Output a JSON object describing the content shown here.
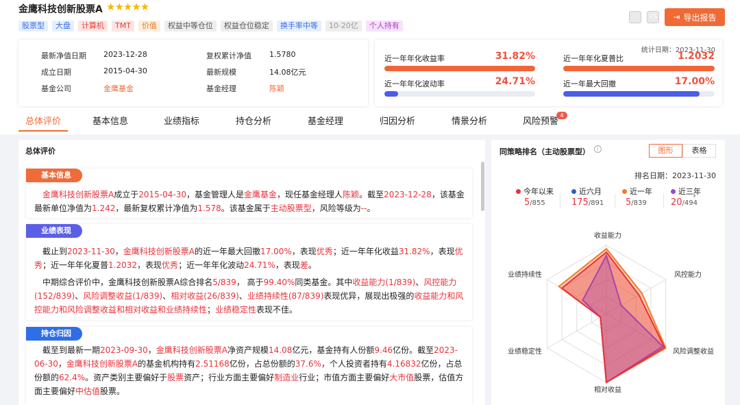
{
  "header": {
    "title": "金鹰科技创新股票A",
    "stars": "★★★★★",
    "tags": [
      "股票型",
      "大盘",
      "计算机",
      "TMT",
      "价值",
      "权益中等仓位",
      "权益仓位稳定",
      "换手率中等",
      "10-20亿",
      "个人持有"
    ],
    "icon_btn_vs": "VS",
    "export_label": "导出报告"
  },
  "info": {
    "nav_date_label": "最新净值日期",
    "nav_date": "2023-12-28",
    "cum_nav_label": "复权累计净值",
    "cum_nav": "1.5780",
    "est_label": "成立日期",
    "est_date": "2015-04-30",
    "scale_label": "最新规模",
    "scale": "14.08亿元",
    "company_label": "基金公司",
    "company": "金鹰基金",
    "manager_label": "基金经理",
    "manager": "陈颖"
  },
  "metrics": {
    "stat_date": "统计日期：2023-11-30",
    "items": [
      {
        "label": "近一年年化收益率",
        "value": "31.82%",
        "fill": 1.0,
        "color": "#f0653a"
      },
      {
        "label": "近一年年化夏普比",
        "value": "1.2032",
        "fill": 1.0,
        "color": "#f0653a"
      },
      {
        "label": "近一年年化波动率",
        "value": "24.71%",
        "fill": 0.09,
        "color": "#4a5ee6"
      },
      {
        "label": "近一年最大回撤",
        "value": "17.00%",
        "fill": 0.9,
        "color": "#4a5ee6"
      }
    ]
  },
  "tabs": [
    "总体评价",
    "基本信息",
    "业绩指标",
    "持仓分析",
    "基金经理",
    "归因分析",
    "情景分析",
    "风险预警"
  ],
  "tab_badge": "4",
  "left": {
    "heading": "总体评价",
    "basic_tag": "基本信息",
    "perf_tag": "业绩表现",
    "hold_tag": "持仓归因"
  },
  "right": {
    "heading": "同策略排名（主动股票型）",
    "info_icon": "i",
    "seg": [
      "图形",
      "表格"
    ],
    "rank_date": "排名日期：2023-11-30",
    "legend": [
      {
        "name": "今年以来",
        "color": "#e8323a",
        "rank": "5",
        "total": "/855"
      },
      {
        "name": "近六月",
        "color": "#2e5bd6",
        "rank": "175",
        "total": "/891"
      },
      {
        "name": "近一年",
        "color": "#f07a2a",
        "rank": "5",
        "total": "/839"
      },
      {
        "name": "近三年",
        "color": "#8a4de6",
        "rank": "20",
        "total": "/494"
      }
    ],
    "axes": [
      "收益能力",
      "风控能力",
      "风险调整收益",
      "相对收益",
      "业绩稳定性",
      "业绩持续性"
    ]
  },
  "chart_data": {
    "type": "radar",
    "categories": [
      "收益能力",
      "风控能力",
      "风险调整收益",
      "相对收益",
      "业绩稳定性",
      "业绩持续性"
    ],
    "series": [
      {
        "name": "近一年",
        "color": "#f07a2a",
        "values": [
          0.95,
          0.6,
          1.0,
          1.0,
          0.1,
          0.8
        ]
      },
      {
        "name": "近三年",
        "color": "#8a4de6",
        "values": [
          0.85,
          0.25,
          0.95,
          1.0,
          0.1,
          0.4
        ]
      },
      {
        "name": "今年以来",
        "color": "#e8323a",
        "values": [
          0.9,
          0.55,
          0.98,
          1.0,
          0.1,
          0.75
        ]
      }
    ]
  }
}
